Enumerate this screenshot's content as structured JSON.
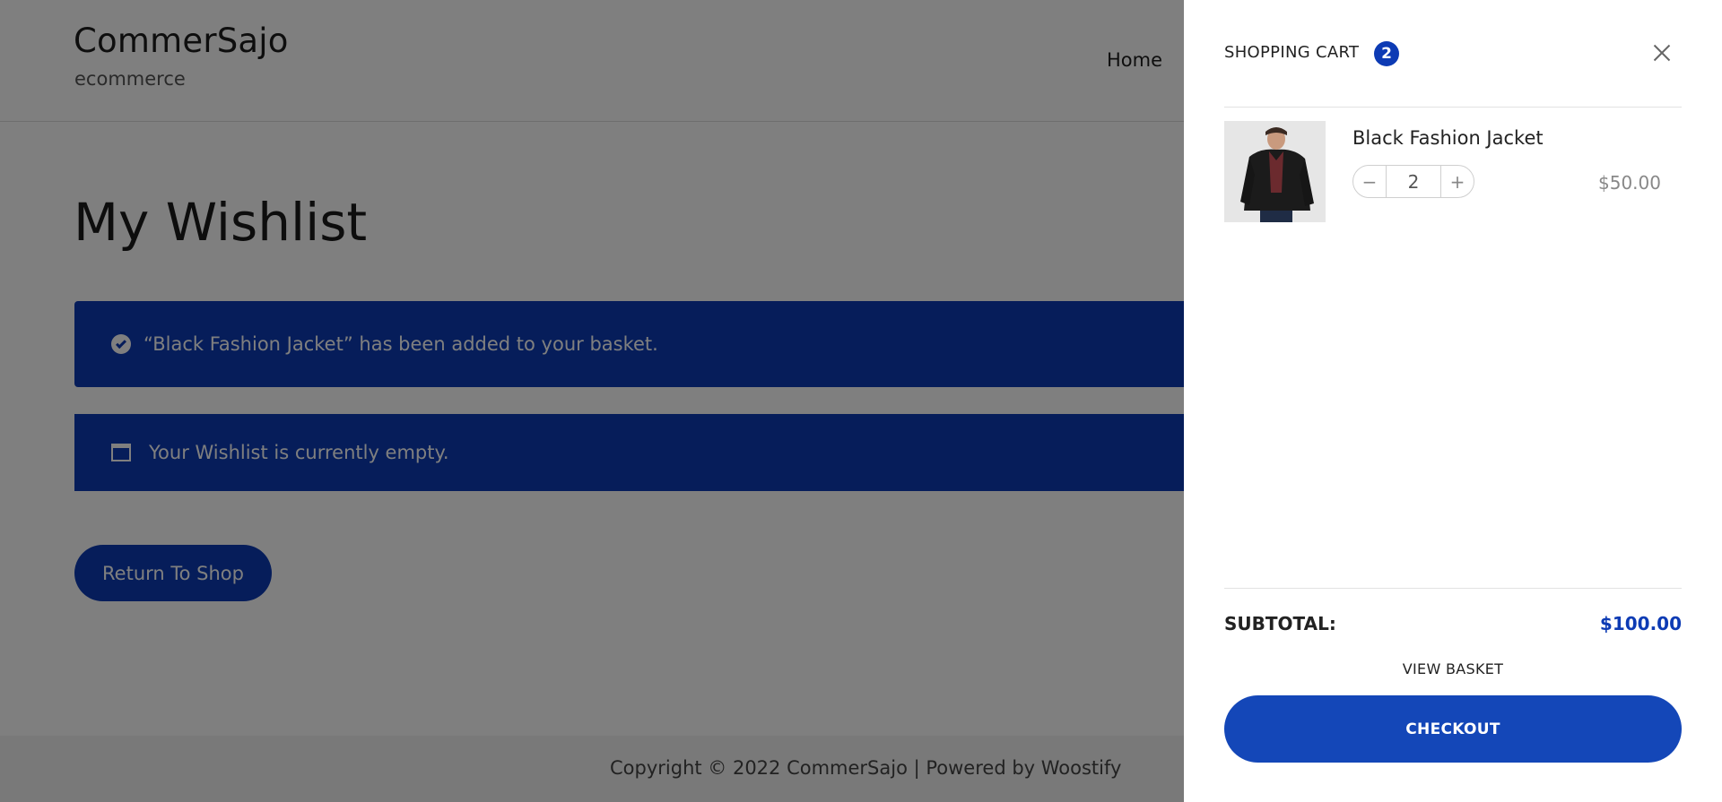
{
  "site": {
    "title": "CommerSajo",
    "tagline": "ecommerce",
    "nav": {
      "home": "Home"
    }
  },
  "page": {
    "title": "My Wishlist",
    "notice_success": "“Black Fashion Jacket” has been added to your basket.",
    "notice_info": "Your Wishlist is currently empty.",
    "return_button": "Return To Shop"
  },
  "footer": {
    "copyright": "Copyright © 2022 CommerSajo | Powered by Woostify"
  },
  "cart": {
    "title": "SHOPPING CART",
    "count": "2",
    "items": [
      {
        "name": "Black Fashion Jacket",
        "quantity": "2",
        "price": "$50.00",
        "minus": "−",
        "plus": "+"
      }
    ],
    "subtotal_label": "SUBTOTAL:",
    "subtotal_value": "$100.00",
    "view_basket": "VIEW BASKET",
    "checkout": "CHECKOUT"
  },
  "colors": {
    "accent": "#0d3bb4",
    "checkout": "#1447b8",
    "overlay": "rgba(0,0,0,0.5)"
  },
  "icons": {
    "success": "check-circle-icon",
    "info": "window-icon",
    "close": "close-icon"
  }
}
